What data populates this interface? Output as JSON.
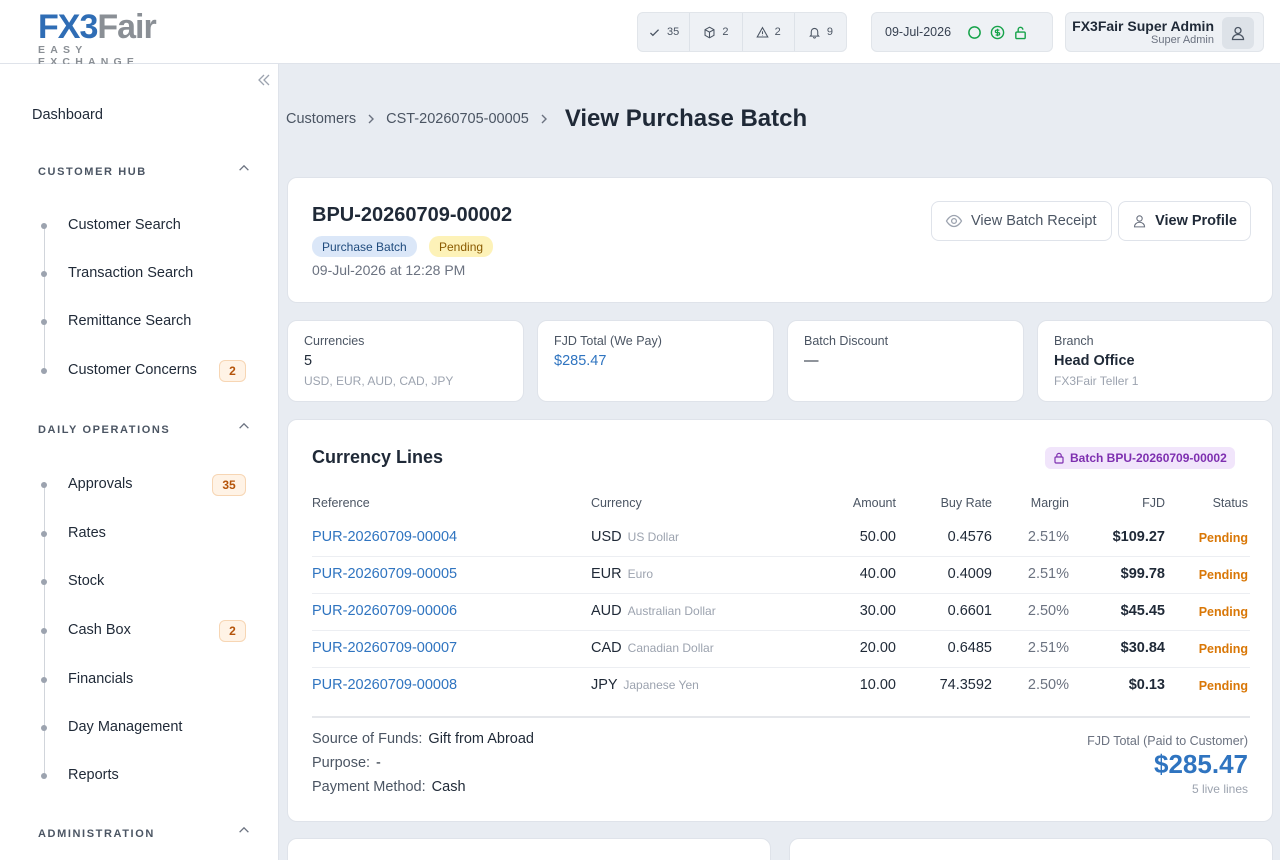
{
  "brand": {
    "logo_part1": "FX3",
    "logo_part2": "Fair",
    "tagline": "EASY EXCHANGE",
    "primary_color": "#2f6db5",
    "secondary_color": "#8a8f95"
  },
  "topbar": {
    "counters": [
      {
        "icon": "check-icon",
        "value": "35"
      },
      {
        "icon": "box-icon",
        "value": "2"
      },
      {
        "icon": "warning-icon",
        "value": "2"
      },
      {
        "icon": "bell-icon",
        "value": "9"
      }
    ],
    "date": "09-Jul-2026",
    "status_icons": [
      "circle-status-icon",
      "dollar-icon",
      "unlock-icon"
    ],
    "status_color": "#16a34a",
    "user_name": "FX3Fair Super Admin",
    "user_role": "Super Admin"
  },
  "sidebar": {
    "dashboard": "Dashboard",
    "sections": [
      {
        "title": "CUSTOMER HUB",
        "items": [
          {
            "label": "Customer Search"
          },
          {
            "label": "Transaction Search"
          },
          {
            "label": "Remittance Search"
          },
          {
            "label": "Customer Concerns",
            "badge": "2"
          }
        ]
      },
      {
        "title": "DAILY OPERATIONS",
        "items": [
          {
            "label": "Approvals",
            "badge": "35"
          },
          {
            "label": "Rates"
          },
          {
            "label": "Stock"
          },
          {
            "label": "Cash Box",
            "badge": "2"
          },
          {
            "label": "Financials"
          },
          {
            "label": "Day Management"
          },
          {
            "label": "Reports"
          }
        ]
      },
      {
        "title": "ADMINISTRATION",
        "items": []
      }
    ]
  },
  "breadcrumb": {
    "items": [
      "Customers",
      "CST-20260705-00005"
    ],
    "current": "View Purchase Batch"
  },
  "batch": {
    "id": "BPU-20260709-00002",
    "type_badge": "Purchase Batch",
    "status_badge": "Pending",
    "datetime": "09-Jul-2026 at 12:28 PM",
    "receipt_button": "View Batch Receipt",
    "profile_button": "View Profile"
  },
  "stats": [
    {
      "label": "Currencies",
      "value": "5",
      "sub": "USD, EUR, AUD, CAD, JPY"
    },
    {
      "label": "FJD Total (We Pay)",
      "value": "$285.47",
      "sub": ""
    },
    {
      "label": "Batch Discount",
      "value": "—",
      "sub": ""
    },
    {
      "label": "Branch",
      "value": "Head Office",
      "sub": "FX3Fair Teller 1"
    }
  ],
  "lines": {
    "title": "Currency Lines",
    "batch_tag": "Batch BPU-20260709-00002",
    "columns": {
      "reference": "Reference",
      "currency": "Currency",
      "amount": "Amount",
      "buy_rate": "Buy Rate",
      "margin": "Margin",
      "fjd": "FJD",
      "status": "Status"
    },
    "rows": [
      {
        "reference": "PUR-20260709-00004",
        "code": "USD",
        "name": "US Dollar",
        "amount": "50.00",
        "buy_rate": "0.4576",
        "margin": "2.51%",
        "fjd": "$109.27",
        "status": "Pending"
      },
      {
        "reference": "PUR-20260709-00005",
        "code": "EUR",
        "name": "Euro",
        "amount": "40.00",
        "buy_rate": "0.4009",
        "margin": "2.51%",
        "fjd": "$99.78",
        "status": "Pending"
      },
      {
        "reference": "PUR-20260709-00006",
        "code": "AUD",
        "name": "Australian Dollar",
        "amount": "30.00",
        "buy_rate": "0.6601",
        "margin": "2.50%",
        "fjd": "$45.45",
        "status": "Pending"
      },
      {
        "reference": "PUR-20260709-00007",
        "code": "CAD",
        "name": "Canadian Dollar",
        "amount": "20.00",
        "buy_rate": "0.6485",
        "margin": "2.51%",
        "fjd": "$30.84",
        "status": "Pending"
      },
      {
        "reference": "PUR-20260709-00008",
        "code": "JPY",
        "name": "Japanese Yen",
        "amount": "10.00",
        "buy_rate": "74.3592",
        "margin": "2.50%",
        "fjd": "$0.13",
        "status": "Pending"
      }
    ],
    "footer": {
      "source_label": "Source of Funds:",
      "source_value": "Gift from Abroad",
      "purpose_label": "Purpose:",
      "purpose_value": "-",
      "method_label": "Payment Method:",
      "method_value": "Cash",
      "total_label": "FJD Total (Paid to Customer)",
      "total_value": "$285.47",
      "total_sub": "5 live lines"
    }
  }
}
